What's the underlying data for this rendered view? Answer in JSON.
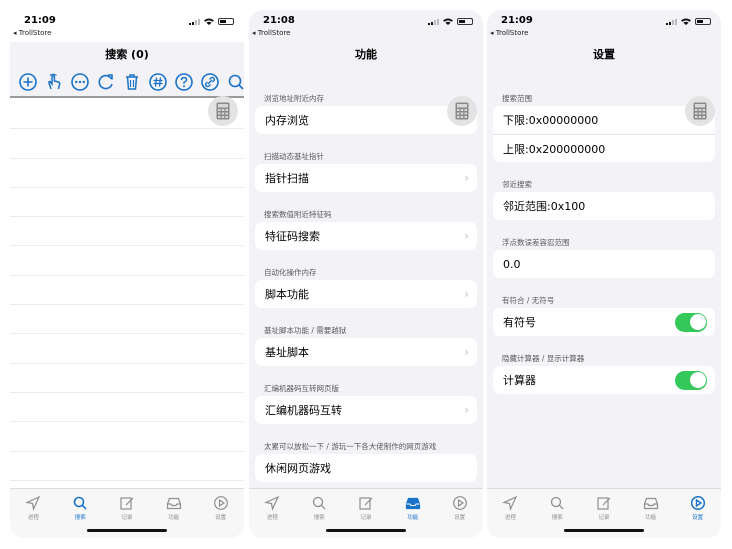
{
  "status_bars": [
    {
      "time": "21:09",
      "back": "◂ TrollStore"
    },
    {
      "time": "21:08",
      "back": "◂ TrollStore"
    },
    {
      "time": "21:09",
      "back": "◂ TrollStore"
    }
  ],
  "screen1": {
    "title": "搜索 (0)",
    "toolbar_icons": [
      "add-circle-icon",
      "tap-gesture-icon",
      "more-circle-icon",
      "refresh-icon",
      "trash-icon",
      "hash-icon",
      "help-icon",
      "link-icon",
      "search-icon"
    ],
    "accent": "#1a73c9"
  },
  "screen2": {
    "title": "功能",
    "sections": [
      {
        "header": "浏览地址附近内存",
        "item": "内存浏览"
      },
      {
        "header": "扫描动态基址指针",
        "item": "指针扫描"
      },
      {
        "header": "搜索数值附近特征码",
        "item": "特征码搜索"
      },
      {
        "header": "自动化操作内存",
        "item": "脚本功能"
      },
      {
        "header": "基址脚本功能 / 需要越狱",
        "item": "基址脚本"
      },
      {
        "header": "汇编机器码互转网页版",
        "item": "汇编机器码互转"
      },
      {
        "header": "太累可以放松一下 / 游玩一下各大佬制作的网页游戏",
        "item": "休闲网页游戏"
      }
    ]
  },
  "screen3": {
    "title": "设置",
    "search_range": {
      "header": "搜索范围",
      "lower": "下限:0x00000000",
      "upper": "上限:0x200000000"
    },
    "nearby": {
      "header": "邻近搜索",
      "item": "邻近范围:0x100"
    },
    "float_tolerance": {
      "header": "浮点数误差容忍范围",
      "value": "0.0"
    },
    "signed": {
      "header": "有符合 / 无符号",
      "label": "有符号",
      "on": true
    },
    "calculator": {
      "header": "隐藏计算器 / 显示计算器",
      "label": "计算器",
      "on": true
    },
    "toggle_color": "#34c759"
  },
  "tabbar": {
    "tabs": [
      {
        "label": "进程",
        "icon": "location-arrow-icon"
      },
      {
        "label": "搜索",
        "icon": "search-icon"
      },
      {
        "label": "记录",
        "icon": "edit-icon"
      },
      {
        "label": "功能",
        "icon": "inbox-tray-icon"
      },
      {
        "label": "设置",
        "icon": "play-circle-icon"
      }
    ],
    "active_index": [
      1,
      3,
      4
    ]
  }
}
